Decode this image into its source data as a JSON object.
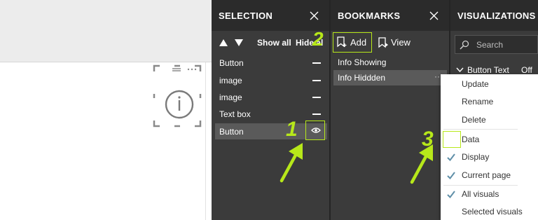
{
  "selection": {
    "title": "SELECTION",
    "show_all": "Show all",
    "hide_all": "Hide all",
    "items": [
      {
        "label": "Button"
      },
      {
        "label": "image"
      },
      {
        "label": "image"
      },
      {
        "label": "Text box"
      },
      {
        "label": "Button"
      }
    ]
  },
  "bookmarks": {
    "title": "BOOKMARKS",
    "add_label": "Add",
    "view_label": "View",
    "items": [
      {
        "label": "Info Showing"
      },
      {
        "label": "Info Hiddden"
      }
    ]
  },
  "visualizations": {
    "title": "VISUALIZATIONS",
    "search_placeholder": "Search",
    "section_label": "Button Text",
    "section_value": "Off"
  },
  "context_menu": {
    "items": [
      {
        "label": "Update",
        "checked": false
      },
      {
        "label": "Rename",
        "checked": false
      },
      {
        "label": "Delete",
        "checked": false
      },
      {
        "label": "Data",
        "checked": false
      },
      {
        "label": "Display",
        "checked": true
      },
      {
        "label": "Current page",
        "checked": true
      },
      {
        "label": "All visuals",
        "checked": true
      },
      {
        "label": "Selected visuals",
        "checked": false
      }
    ]
  },
  "annotations": {
    "step1": "1",
    "step2": "2",
    "step3": "3",
    "highlight_color": "#b7e81a"
  },
  "colors": {
    "pane_bg": "#3b3b3b",
    "header_bg": "#2b2b2b",
    "selected_row": "#5a5a5a",
    "check_color": "#5f8fa8"
  }
}
